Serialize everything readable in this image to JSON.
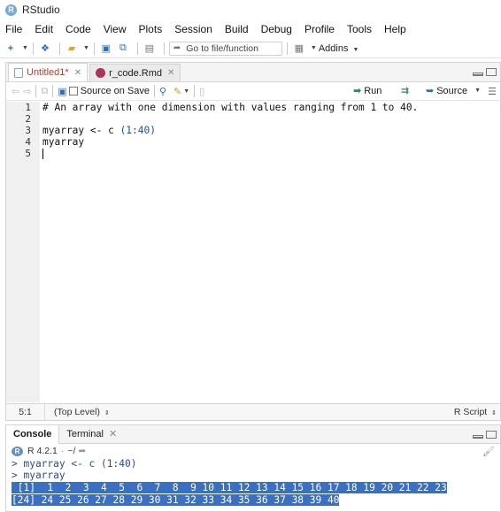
{
  "window": {
    "title": "RStudio",
    "logo_letter": "R"
  },
  "menu": [
    "File",
    "Edit",
    "Code",
    "View",
    "Plots",
    "Session",
    "Build",
    "Debug",
    "Profile",
    "Tools",
    "Help"
  ],
  "toolbar": {
    "goto_placeholder": "Go to file/function",
    "addins_label": "Addins"
  },
  "editor": {
    "tabs": [
      {
        "label": "Untitled1*",
        "active": true
      },
      {
        "label": "r_code.Rmd",
        "active": false
      }
    ],
    "source_on_save_label": "Source on Save",
    "run_label": "Run",
    "source_label": "Source",
    "lines": [
      {
        "num": "1",
        "text": "# An array with one dimension with values ranging from 1 to 40."
      },
      {
        "num": "2",
        "text": ""
      },
      {
        "num": "3",
        "text": "myarray <- c (1:40)"
      },
      {
        "num": "4",
        "text": "myarray"
      },
      {
        "num": "5",
        "text": ""
      }
    ],
    "cursor_position": "5:1",
    "scope": "(Top Level)",
    "file_type": "R Script"
  },
  "console": {
    "tabs": [
      {
        "label": "Console",
        "active": true
      },
      {
        "label": "Terminal",
        "active": false
      }
    ],
    "version": "R 4.2.1",
    "working_dir": "~/",
    "input_lines": [
      "> myarray <- c (1:40)",
      "> myarray"
    ],
    "output_lines": [
      " [1]  1  2  3  4  5  6  7  8  9 10 11 12 13 14 15 16 17 18 19 20 21 22 23",
      "[24] 24 25 26 27 28 29 30 31 32 33 34 35 36 37 38 39 40"
    ]
  },
  "colors": {
    "accent": "#75aadb",
    "selection": "#3b6fc1",
    "comment": "#2a7d4f",
    "active_tab": "#c0392b"
  }
}
